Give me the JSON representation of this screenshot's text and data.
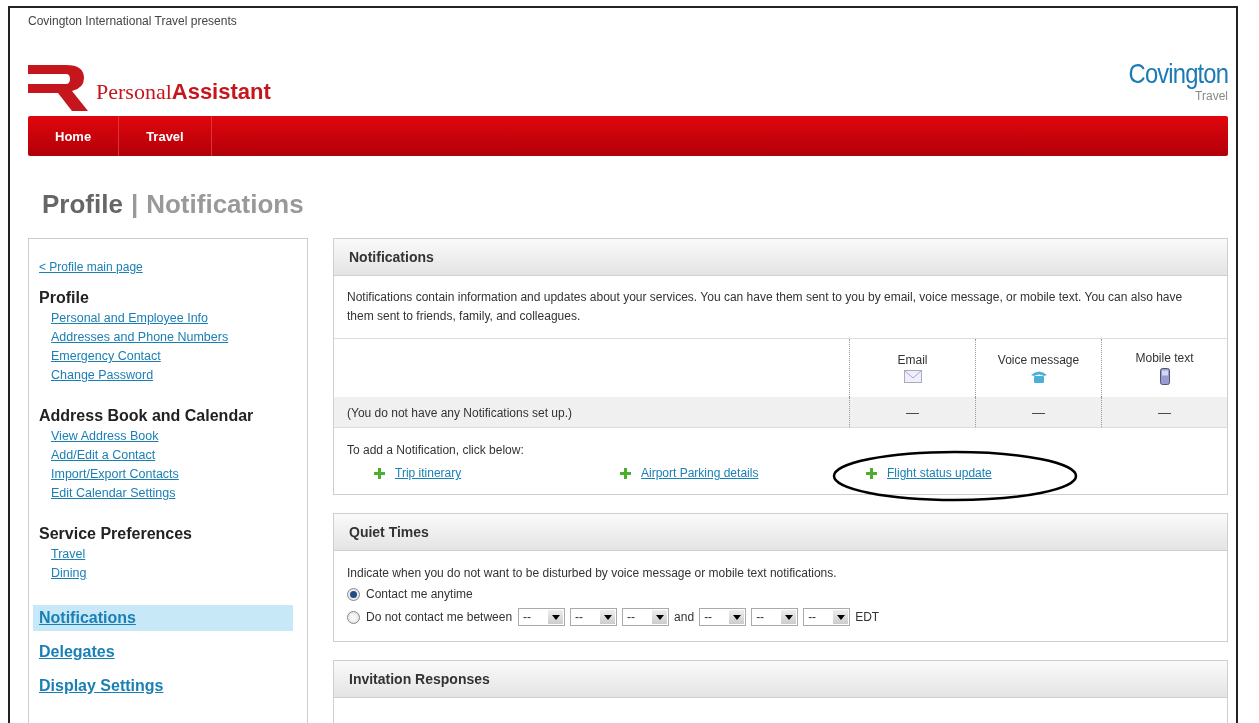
{
  "top_note": "Covington International Travel presents",
  "logo": {
    "regular": "Personal",
    "bold": "Assistant"
  },
  "brand": {
    "name": "Covington",
    "sub": "Travel"
  },
  "nav": [
    "Home",
    "Travel"
  ],
  "page_title": {
    "section": "Profile",
    "separator": "|",
    "page": "Notifications"
  },
  "sidebar": {
    "back_link": "< Profile main page",
    "groups": [
      {
        "title": "Profile",
        "links": [
          "Personal and Employee Info",
          "Addresses and Phone Numbers",
          "Emergency Contact",
          "Change Password"
        ]
      },
      {
        "title": "Address Book and Calendar",
        "links": [
          "View Address Book",
          "Add/Edit a Contact",
          "Import/Export Contacts",
          "Edit Calendar Settings"
        ]
      },
      {
        "title": "Service Preferences",
        "links": [
          "Travel",
          "Dining"
        ]
      }
    ],
    "items": [
      {
        "label": "Notifications",
        "selected": true
      },
      {
        "label": "Delegates",
        "selected": false
      },
      {
        "label": "Display Settings",
        "selected": false
      }
    ]
  },
  "notifications": {
    "title": "Notifications",
    "description": "Notifications contain information and updates about your services. You can have them sent to you by email, voice message, or mobile text. You can also have them sent to friends, family, and colleagues.",
    "columns": [
      "Email",
      "Voice message",
      "Mobile text"
    ],
    "empty_row": {
      "text": "(You do not have any Notifications set up.)",
      "cells": [
        "—",
        "—",
        "—"
      ]
    },
    "add_prompt": "To add a Notification, click below:",
    "add_links": [
      {
        "label": "Trip itinerary",
        "circled": false
      },
      {
        "label": "Airport Parking details",
        "circled": false
      },
      {
        "label": "Flight status update",
        "circled": true
      }
    ]
  },
  "quiet_times": {
    "title": "Quiet Times",
    "description": "Indicate when you do not want to be disturbed by voice message or mobile text notifications.",
    "options": [
      {
        "kind": "plain",
        "label": "Contact me anytime",
        "selected": true
      },
      {
        "kind": "range",
        "label": "Do not contact me between",
        "selected": false
      }
    ],
    "from_selects": [
      "--",
      "--",
      "--"
    ],
    "joiner": "and",
    "to_selects": [
      "--",
      "--",
      "--"
    ],
    "timezone": "EDT"
  },
  "invitation_responses": {
    "title": "Invitation Responses"
  }
}
